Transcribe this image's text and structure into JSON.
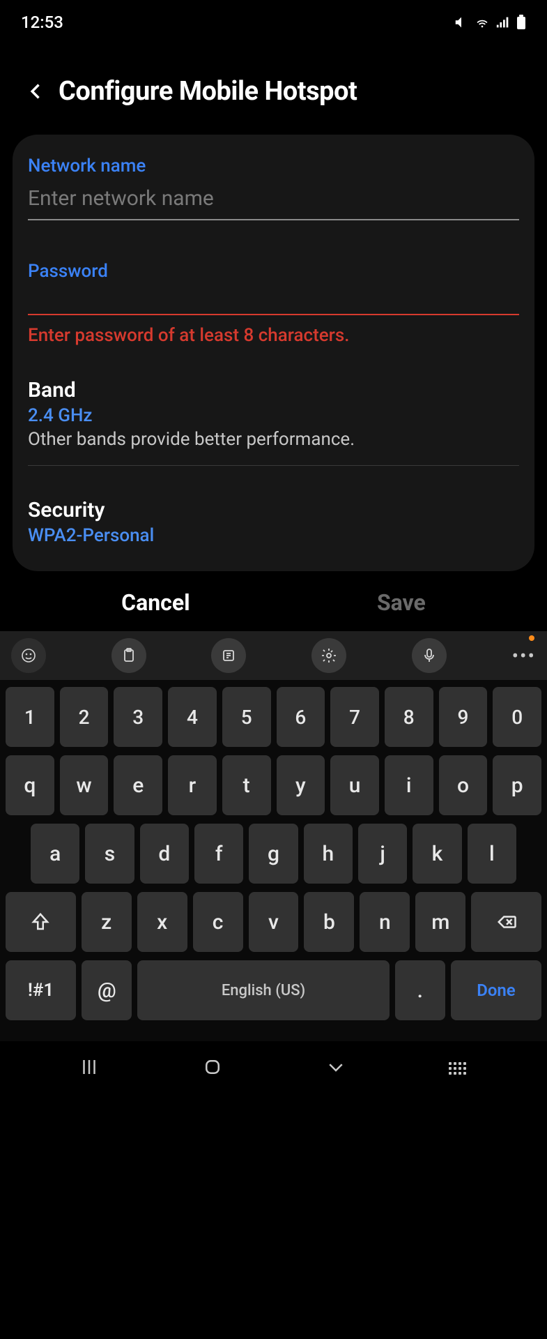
{
  "status": {
    "time": "12:53"
  },
  "header": {
    "title": "Configure Mobile Hotspot"
  },
  "form": {
    "network_label": "Network name",
    "network_placeholder": "Enter network name",
    "network_value": "",
    "password_label": "Password",
    "password_value": "",
    "password_error": "Enter password of at least 8 characters.",
    "band": {
      "title": "Band",
      "value": "2.4 GHz",
      "subtitle": "Other bands provide better performance."
    },
    "security": {
      "title": "Security",
      "value": "WPA2-Personal"
    }
  },
  "dialog": {
    "cancel": "Cancel",
    "save": "Save"
  },
  "keyboard": {
    "row_num": [
      "1",
      "2",
      "3",
      "4",
      "5",
      "6",
      "7",
      "8",
      "9",
      "0"
    ],
    "row1": [
      "q",
      "w",
      "e",
      "r",
      "t",
      "y",
      "u",
      "i",
      "o",
      "p"
    ],
    "row2": [
      "a",
      "s",
      "d",
      "f",
      "g",
      "h",
      "j",
      "k",
      "l"
    ],
    "row3": [
      "z",
      "x",
      "c",
      "v",
      "b",
      "n",
      "m"
    ],
    "symbols": "!#1",
    "at": "@",
    "space": "English (US)",
    "dot": ".",
    "done": "Done"
  }
}
